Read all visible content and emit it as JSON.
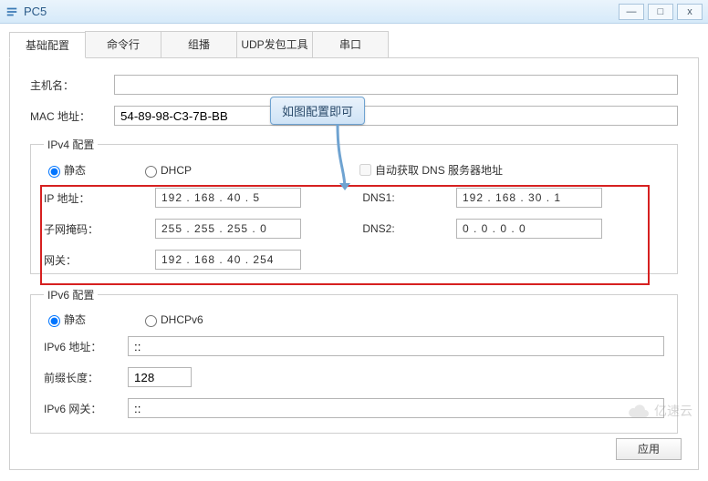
{
  "window": {
    "title": "PC5"
  },
  "tabs": [
    "基础配置",
    "命令行",
    "组播",
    "UDP发包工具",
    "串口"
  ],
  "basic": {
    "hostLabel": "主机名：",
    "hostValue": "",
    "macLabel": "MAC 地址：",
    "macValue": "54-89-98-C3-7B-BB"
  },
  "ipv4": {
    "legend": "IPv4 配置",
    "staticLabel": "静态",
    "dhcpLabel": "DHCP",
    "autoDnsLabel": "自动获取 DNS 服务器地址",
    "ipLabel": "IP 地址：",
    "ipValue": "192  .  168  .  40  .  5",
    "maskLabel": "子网掩码：",
    "maskValue": "255  .  255  .  255  .  0",
    "gwLabel": "网关：",
    "gwValue": "192  .  168  .  40  .  254",
    "dns1Label": "DNS1:",
    "dns1Value": "192  .  168  .  30  .  1",
    "dns2Label": "DNS2:",
    "dns2Value": "0  .  0  .  0  .  0"
  },
  "ipv6": {
    "legend": "IPv6 配置",
    "staticLabel": "静态",
    "dhcpLabel": "DHCPv6",
    "addrLabel": "IPv6 地址：",
    "addrValue": "::",
    "prefixLabel": "前缀长度：",
    "prefixValue": "128",
    "gwLabel": "IPv6 网关：",
    "gwValue": "::"
  },
  "applyLabel": "应用",
  "callout": "如图配置即可",
  "watermark": "亿速云"
}
